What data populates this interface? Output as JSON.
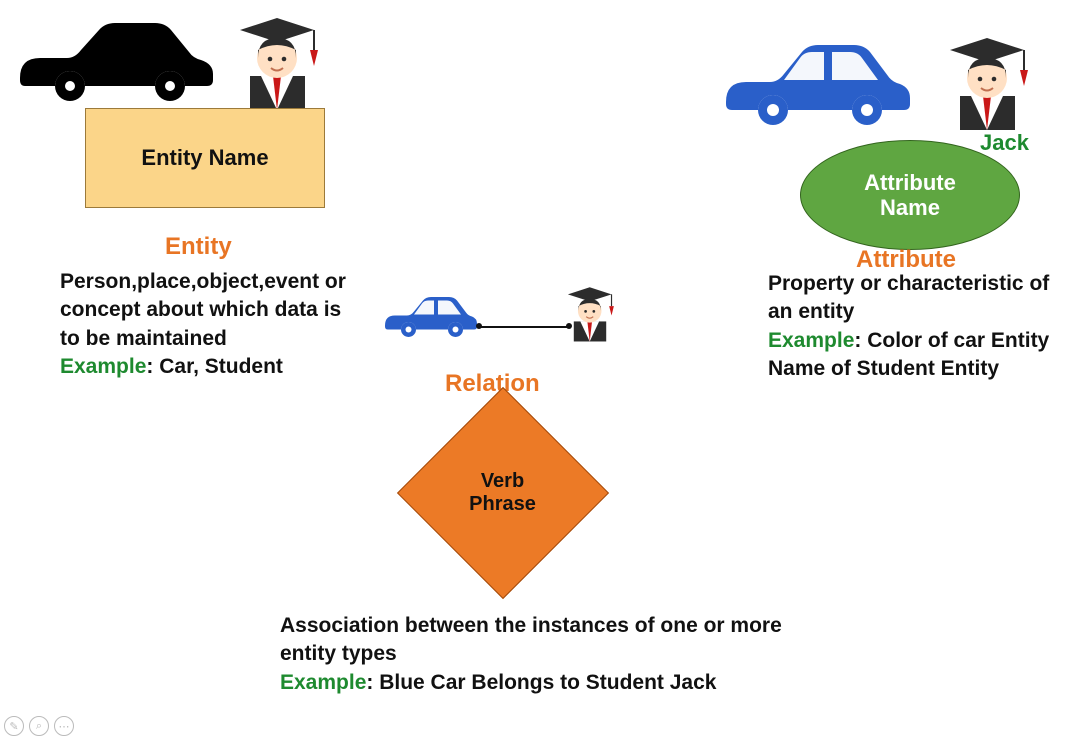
{
  "entity": {
    "box_label": "Entity Name",
    "heading": "Entity",
    "description": "Person,place,object,event or concept about which data is to be maintained",
    "example_label": "Example",
    "example_text": ": Car, Student"
  },
  "attribute": {
    "student_name": "Jack",
    "ellipse_label_line1": "Attribute",
    "ellipse_label_line2": "Name",
    "heading": "Attribute",
    "description": "Property or characteristic of an entity",
    "example_label": "Example",
    "example_text": ": Color of car Entity Name of Student Entity"
  },
  "relation": {
    "heading": "Relation",
    "diamond_label_line1": "Verb",
    "diamond_label_line2": "Phrase",
    "description": "Association between the instances of one or more entity types",
    "example_label": "Example",
    "example_text": ": Blue Car Belongs to Student Jack"
  },
  "icons": {
    "black_car": "black-car-icon",
    "blue_car": "blue-car-icon",
    "student": "student-icon"
  }
}
